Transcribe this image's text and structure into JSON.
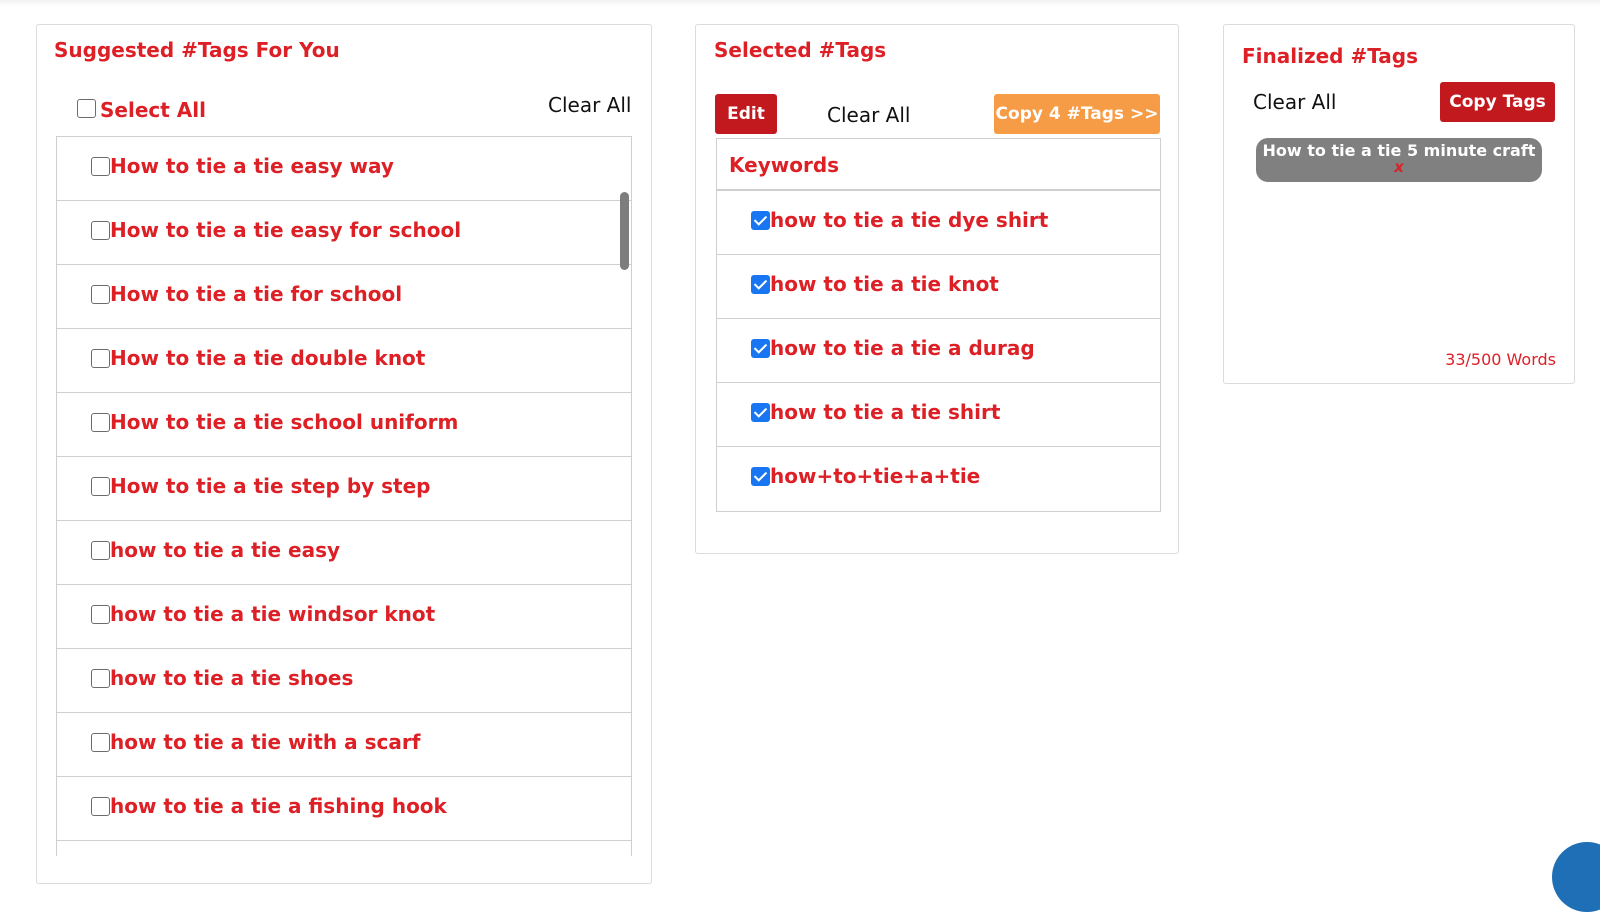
{
  "suggested": {
    "title": "Suggested #Tags For You",
    "select_all_label": "Select All",
    "clear_all_label": "Clear All",
    "items": [
      {
        "label": "How to tie a tie easy way",
        "checked": false
      },
      {
        "label": "How to tie a tie easy for school",
        "checked": false
      },
      {
        "label": "How to tie a tie for school",
        "checked": false
      },
      {
        "label": "How to tie a tie double knot",
        "checked": false
      },
      {
        "label": "How to tie a tie school uniform",
        "checked": false
      },
      {
        "label": "How to tie a tie step by step",
        "checked": false
      },
      {
        "label": "how to tie a tie easy",
        "checked": false
      },
      {
        "label": "how to tie a tie windsor knot",
        "checked": false
      },
      {
        "label": "how to tie a tie shoes",
        "checked": false
      },
      {
        "label": "how to tie a tie with a scarf",
        "checked": false
      },
      {
        "label": "how to tie a tie a fishing hook",
        "checked": false
      }
    ]
  },
  "selected": {
    "title": "Selected #Tags",
    "edit_label": "Edit",
    "clear_all_label": "Clear All",
    "copy_label": "Copy 4 #Tags >>",
    "keywords_header": "Keywords",
    "items": [
      {
        "label": "how to tie a tie dye shirt",
        "checked": true
      },
      {
        "label": "how to tie a tie knot",
        "checked": true
      },
      {
        "label": "how to tie a tie a durag",
        "checked": true
      },
      {
        "label": "how to tie a tie shirt",
        "checked": true
      },
      {
        "label": "how+to+tie+a+tie",
        "checked": true
      }
    ]
  },
  "finalized": {
    "title": "Finalized #Tags",
    "clear_all_label": "Clear All",
    "copy_label": "Copy Tags",
    "tags": [
      {
        "label": "How to tie a tie 5 minute craft",
        "remove": "x"
      }
    ],
    "word_count": "33/500 Words"
  },
  "colors": {
    "accent_red": "#dd1f26",
    "dark_red_button": "#c2191f",
    "orange_button": "#f69c47",
    "checkbox_blue": "#1976f2",
    "chip_gray": "#808080"
  }
}
